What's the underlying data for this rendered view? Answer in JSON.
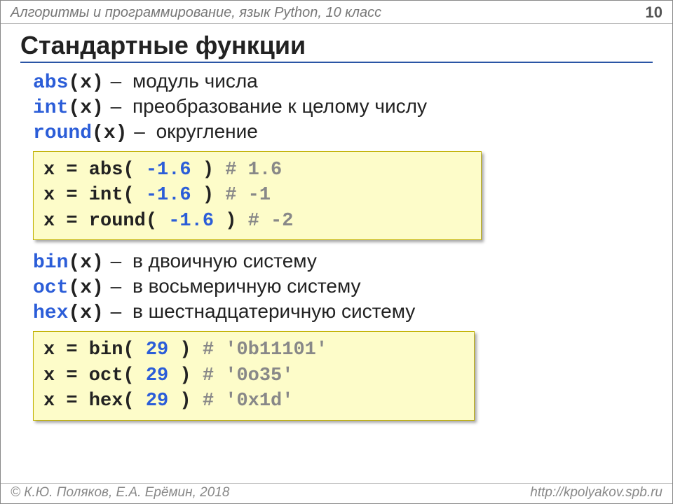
{
  "header": {
    "breadcrumb": "Алгоритмы и программирование, язык Python, 10 класс",
    "page_number": "10"
  },
  "title": "Стандартные функции",
  "defs_top": [
    {
      "fn": "abs",
      "arg": "(x)",
      "desc": "модуль числа"
    },
    {
      "fn": "int",
      "arg": "(x)",
      "desc": "преобразование к целому числу"
    },
    {
      "fn": "round",
      "arg": "(x)",
      "desc": "округление"
    }
  ],
  "code1": [
    {
      "pre": "x = abs( ",
      "num": "-1.6",
      "post": " )    ",
      "cmt": "# 1.6"
    },
    {
      "pre": "x = int( ",
      "num": "-1.6",
      "post": " )    ",
      "cmt": "# -1"
    },
    {
      "pre": "x = round( ",
      "num": "-1.6",
      "post": " )  ",
      "cmt": "# -2"
    }
  ],
  "defs_bottom": [
    {
      "fn": "bin",
      "arg": "(x)",
      "desc": "в двоичную систему"
    },
    {
      "fn": "oct",
      "arg": "(x)",
      "desc": "в восьмеричную систему"
    },
    {
      "fn": "hex",
      "arg": "(x)",
      "desc": "в шестнадцатеричную систему"
    }
  ],
  "code2": [
    {
      "pre": "x = bin( ",
      "num": "29",
      "post": " )   ",
      "cmt": "# '0b11101'"
    },
    {
      "pre": "x = oct( ",
      "num": "29",
      "post": " )   ",
      "cmt": "# '0o35'"
    },
    {
      "pre": "x = hex( ",
      "num": "29",
      "post": " )   ",
      "cmt": "# '0x1d'"
    }
  ],
  "footer": {
    "copyright": "© К.Ю. Поляков, Е.А. Ерёмин, 2018",
    "url": "http://kpolyakov.spb.ru"
  },
  "dash": "–"
}
